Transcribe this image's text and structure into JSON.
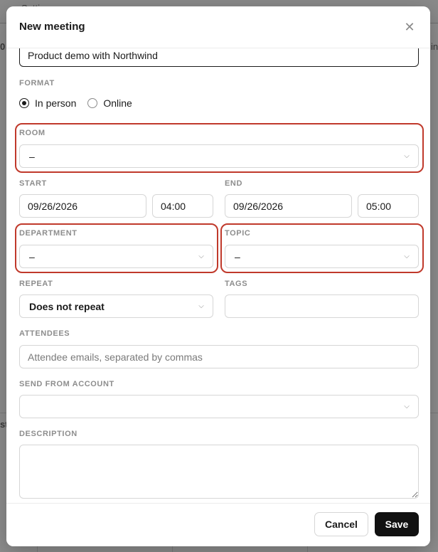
{
  "background": {
    "top_item": "Settings",
    "left_fragment": "0",
    "right_fragment": "in",
    "mid_fragment": "st"
  },
  "dialog": {
    "title": "New meeting",
    "close_icon": "close-icon"
  },
  "form": {
    "title_value": "Product demo with Northwind",
    "format": {
      "label": "FORMAT",
      "options": [
        "In person",
        "Online"
      ],
      "selected": "In person"
    },
    "room": {
      "label": "ROOM",
      "value": "–"
    },
    "start": {
      "label": "START",
      "date": "09/26/2026",
      "time": "04:00"
    },
    "end": {
      "label": "END",
      "date": "09/26/2026",
      "time": "05:00"
    },
    "department": {
      "label": "DEPARTMENT",
      "value": "–"
    },
    "topic": {
      "label": "TOPIC",
      "value": "–"
    },
    "repeat": {
      "label": "REPEAT",
      "value": "Does not repeat"
    },
    "tags": {
      "label": "TAGS",
      "value": ""
    },
    "attendees": {
      "label": "ATTENDEES",
      "placeholder": "Attendee emails, separated by commas"
    },
    "send_from": {
      "label": "SEND FROM ACCOUNT",
      "value": ""
    },
    "description": {
      "label": "DESCRIPTION",
      "value": ""
    }
  },
  "footer": {
    "cancel_label": "Cancel",
    "save_label": "Save"
  },
  "colors": {
    "highlight": "#c0392b",
    "primary_button": "#111111"
  }
}
